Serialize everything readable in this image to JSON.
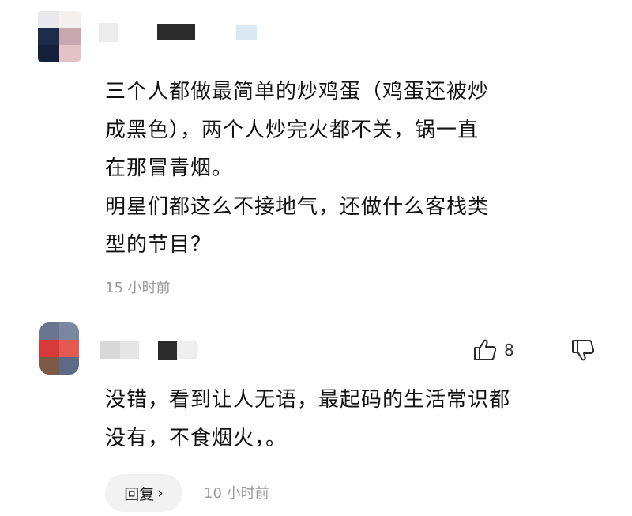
{
  "comments": [
    {
      "text": "三个人都做最简单的炒鸡蛋（鸡蛋还被炒\n成黑色），两个人炒完火都不关，锅一直\n在那冒青烟。\n明星们都这么不接地气，还做什么客栈类\n型的节目？",
      "time": "15 小时前",
      "avatar_colors": [
        "#e9e9eb",
        "#f3f0f0",
        "#1c2c48",
        "#c9a7ae",
        "#15213a",
        "#e3c3c8"
      ],
      "name_blur_colors": [
        "#ececec",
        "#2b2b2b",
        "#dbe9f5"
      ]
    },
    {
      "text": "没错，看到让人无语，最起码的生活常识都\n没有，不食烟火，。",
      "time": "10 小时前",
      "like_count": "8",
      "reply_label": "回复",
      "reply_chevron": "›",
      "icons": {
        "like": "thumbs-up-icon",
        "dislike": "thumbs-down-icon"
      },
      "avatar_colors": [
        "#6a7590",
        "#7b86a0",
        "#d83a3a",
        "#e45a50",
        "#7c5a45",
        "#5c6a86"
      ],
      "name_blur_colors": [
        "#d8d8d8",
        "#e6e6e6",
        "#2a2a2a",
        "#eeeeee"
      ]
    }
  ]
}
